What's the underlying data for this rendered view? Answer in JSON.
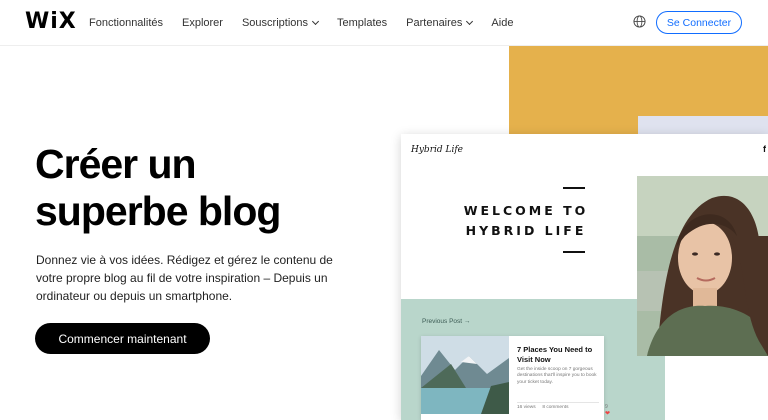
{
  "header": {
    "logo": "WiX",
    "nav": [
      {
        "label": "Fonctionnalités",
        "has_dropdown": false
      },
      {
        "label": "Explorer",
        "has_dropdown": false
      },
      {
        "label": "Souscriptions",
        "has_dropdown": true
      },
      {
        "label": "Templates",
        "has_dropdown": false
      },
      {
        "label": "Partenaires",
        "has_dropdown": true
      },
      {
        "label": "Aide",
        "has_dropdown": false
      }
    ],
    "globe_icon": "globe-icon",
    "login_label": "Se Connecter",
    "login_color": "#116dff"
  },
  "hero": {
    "title_line1": "Créer un",
    "title_line2": "superbe blog",
    "description": "Donnez vie à vos idées. Rédigez et gérez le contenu de votre propre blog au fil de votre inspiration – Depuis un ordinateur ou depuis un smartphone.",
    "cta_label": "Commencer maintenant"
  },
  "mockup": {
    "brand": "Hybrid Life",
    "social_icon": "f",
    "welcome_line1": "WELCOME TO",
    "welcome_line2": "HYBRID LIFE",
    "previous_post": "Previous Post →",
    "card": {
      "title": "7 Places You Need to Visit Now",
      "excerpt": "Get the inside scoop on 7 gorgeous destinations that'll inspire you to book your ticket today.",
      "views": "16 views",
      "comments": "8 comments",
      "likes": "9"
    },
    "colors": {
      "yellow": "#e5b14c",
      "mint": "#b9d6cb"
    }
  }
}
